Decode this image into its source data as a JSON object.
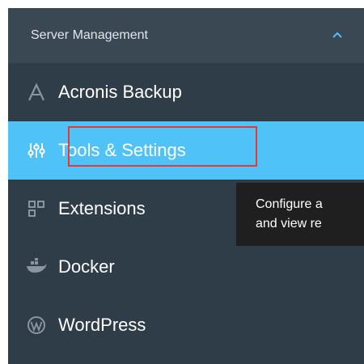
{
  "sidebar": {
    "section_title": "Server Management",
    "items": [
      {
        "label": "Acronis Backup",
        "icon": "acronis-icon"
      },
      {
        "label": "Tools & Settings",
        "icon": "tools-icon",
        "active": true
      },
      {
        "label": "Extensions",
        "icon": "extensions-icon"
      },
      {
        "label": "Docker",
        "icon": "docker-icon"
      },
      {
        "label": "WordPress",
        "icon": "wordpress-icon"
      }
    ]
  },
  "tooltip": {
    "line1": "Configure a",
    "line2": "and view re"
  },
  "colors": {
    "sidebar_bg": "#2f3d48",
    "header_bg": "#3a4853",
    "active_bg": "#4fc3f7",
    "highlight": "#e53935",
    "tooltip_bg": "#1f1f1f"
  }
}
